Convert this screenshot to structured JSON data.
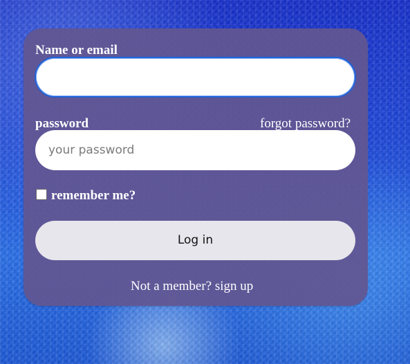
{
  "form": {
    "name_label": "Name or email",
    "name_value": "",
    "password_label": "password",
    "forgot_password": "forgot password?",
    "password_value": "",
    "password_placeholder": "your password",
    "remember_label": "remember me?",
    "login_label": "Log in",
    "signup_text": "Not a member? sign up"
  }
}
